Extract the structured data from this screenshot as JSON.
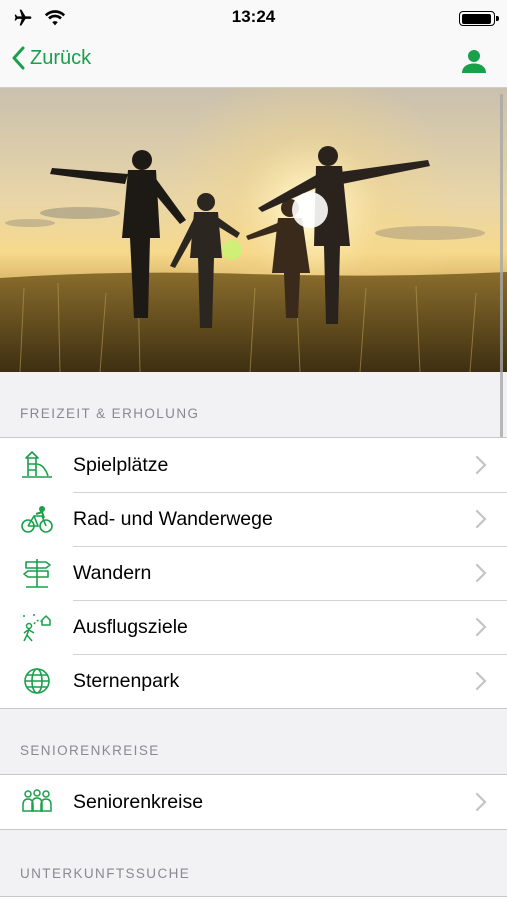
{
  "status": {
    "time": "13:24"
  },
  "nav": {
    "back_label": "Zurück"
  },
  "colors": {
    "accent": "#19a04a",
    "section_text": "#8a8a8e"
  },
  "sections": [
    {
      "title": "FREIZEIT & ERHOLUNG",
      "items": [
        {
          "label": "Spielplätze",
          "icon": "playground-icon"
        },
        {
          "label": "Rad- und Wanderwege",
          "icon": "bicycle-icon"
        },
        {
          "label": "Wandern",
          "icon": "signpost-icon"
        },
        {
          "label": "Ausflugsziele",
          "icon": "hiking-destination-icon"
        },
        {
          "label": "Sternenpark",
          "icon": "globe-icon"
        }
      ]
    },
    {
      "title": "SENIORENKREISE",
      "items": [
        {
          "label": "Seniorenkreise",
          "icon": "group-icon"
        }
      ]
    },
    {
      "title": "UNTERKUNFTSSUCHE",
      "items": []
    }
  ]
}
